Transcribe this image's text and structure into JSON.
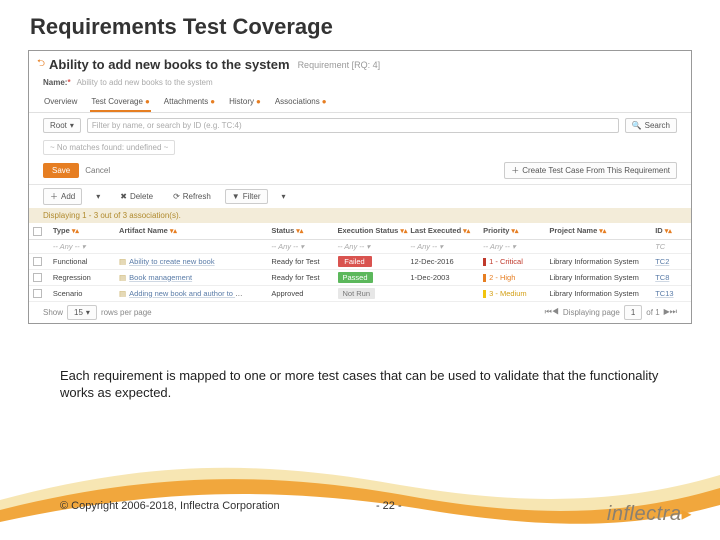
{
  "slide_title": "Requirements Test Coverage",
  "header": {
    "title": "Ability to add new books to the system",
    "type_label": "Requirement [RQ: 4]"
  },
  "name_row": {
    "label": "Name:",
    "value": "Ability to add new books to the system"
  },
  "tabs": [
    {
      "label": "Overview",
      "marker": false
    },
    {
      "label": "Test Coverage",
      "marker": true,
      "active": true
    },
    {
      "label": "Attachments",
      "marker": true
    },
    {
      "label": "History",
      "marker": true
    },
    {
      "label": "Associations",
      "marker": true
    }
  ],
  "search": {
    "root": "Root",
    "placeholder": "Filter by name, or search by ID (e.g. TC:4)",
    "button": "Search"
  },
  "nomatch": "~ No matches found: undefined ~",
  "actions": {
    "save": "Save",
    "cancel": "Cancel",
    "create": "Create Test Case From This Requirement"
  },
  "toolbar2": {
    "add": "Add",
    "delete": "Delete",
    "refresh": "Refresh",
    "filter": "Filter"
  },
  "display": "Displaying 1 - 3 out of 3 association(s).",
  "columns": {
    "type": "Type",
    "artifact": "Artifact Name",
    "status": "Status",
    "exec": "Execution Status",
    "last": "Last Executed",
    "priority": "Priority",
    "project": "Project Name",
    "id": "ID"
  },
  "any": "-- Any --",
  "rows": [
    {
      "type": "Functional",
      "artifact": "Ability to create new book",
      "status": "Ready for Test",
      "exec": "Failed",
      "exec_class": "red",
      "last": "12-Dec-2016",
      "priority": "1 - Critical",
      "pri_class": "pri1",
      "pbar": "p1",
      "project": "Library Information System",
      "id": "TC2"
    },
    {
      "type": "Regression",
      "artifact": "Book management",
      "status": "Ready for Test",
      "exec": "Passed",
      "exec_class": "green",
      "last": "1-Dec-2003",
      "priority": "2 - High",
      "pri_class": "pri2",
      "pbar": "p2",
      "project": "Library Information System",
      "id": "TC8"
    },
    {
      "type": "Scenario",
      "artifact": "Adding new book and author to library",
      "status": "Approved",
      "exec": "Not Run",
      "exec_class": "gray",
      "last": "",
      "priority": "3 - Medium",
      "pri_class": "pri3",
      "pbar": "p3",
      "project": "Library Information System",
      "id": "TC13"
    }
  ],
  "pager": {
    "show": "Show",
    "count": "15",
    "rows": "rows per page",
    "right": "Displaying page",
    "page": "1",
    "of": "of 1"
  },
  "caption": "Each requirement is mapped to one or more test cases that can be used to validate that the functionality works as expected.",
  "copyright": "© Copyright 2006-2018, Inflectra Corporation",
  "pagenum": "- 22 -",
  "logo": "inflectra"
}
